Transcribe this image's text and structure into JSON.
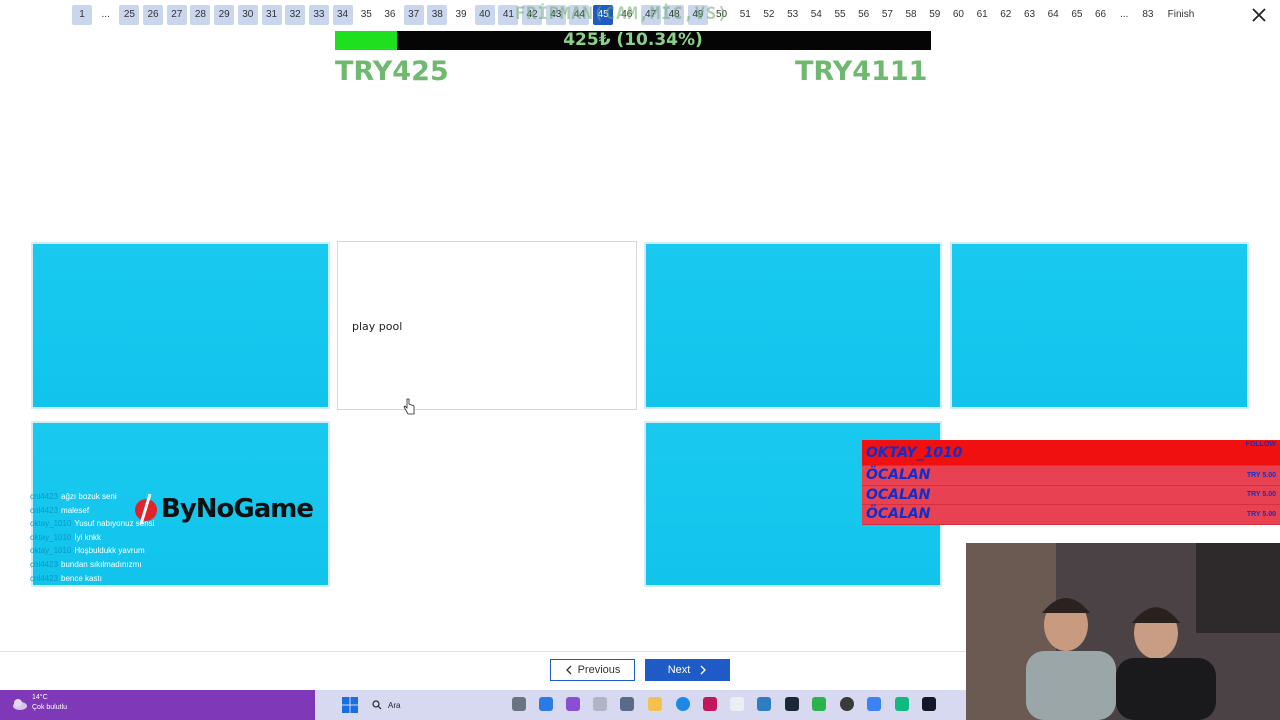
{
  "pager": {
    "first": "1",
    "ellipsis_left": "...",
    "pages": [
      "25",
      "26",
      "27",
      "28",
      "29",
      "30",
      "31",
      "32",
      "33",
      "34",
      "35",
      "36",
      "37",
      "38",
      "39",
      "40",
      "41",
      "42",
      "43",
      "44",
      "45",
      "46",
      "47",
      "48",
      "49",
      "50",
      "51",
      "52",
      "53",
      "54",
      "55",
      "56",
      "57",
      "58",
      "59",
      "60",
      "61",
      "62",
      "63",
      "64",
      "65",
      "66"
    ],
    "filled_pages": [
      "1",
      "25",
      "26",
      "27",
      "28",
      "29",
      "30",
      "31",
      "32",
      "33",
      "34",
      "37",
      "38",
      "40",
      "41",
      "42",
      "43",
      "44",
      "47",
      "48",
      "49"
    ],
    "active_page": "45",
    "ellipsis_right": "...",
    "last": "83",
    "finish_label": "Finish"
  },
  "overlay": {
    "title": "FRİPMAN(CAM,MİC,VS)",
    "progress_text": "425₺ (10.34%)",
    "progress_fraction": 0.1034,
    "amount_left": "TRY425",
    "amount_right": "TRY4111"
  },
  "cards": {
    "card2_text": "play pool"
  },
  "chat": {
    "lines": [
      {
        "user": "cnl4423",
        "text": "ağzı bozuk seni"
      },
      {
        "user": "cnl4423",
        "text": "malesef"
      },
      {
        "user": "oktay_1010",
        "text": "Yusuf nabıyonuz sensi"
      },
      {
        "user": "oktay_1010",
        "text": "İyi knkk"
      },
      {
        "user": "oktay_1010",
        "text": "Hoşbuldukk yavrum"
      },
      {
        "user": "cnl4423",
        "text": "bundan sıkılmadınızmı"
      },
      {
        "user": "cnl4423",
        "text": "bence kastı"
      }
    ],
    "brand": "ByNoGame"
  },
  "donations": {
    "header_label": "FOLLOW",
    "rows": [
      {
        "name": "OKTAY_1010",
        "amount": ""
      },
      {
        "name": "ÖCALAN",
        "amount": "TRY 5.00"
      },
      {
        "name": "OCALAN",
        "amount": "TRY 5.00"
      },
      {
        "name": "ÖCALAN",
        "amount": "TRY 5.00"
      }
    ]
  },
  "nav": {
    "previous_label": "Previous",
    "next_label": "Next"
  },
  "taskbar": {
    "weather_temp": "14°C",
    "weather_desc": "Çok bulutlu",
    "search_placeholder": "Ara"
  },
  "colors": {
    "card_cyan": "#19c9ef",
    "accent_blue": "#1e5bc6",
    "progress_green": "#1fe01f",
    "amount_green": "#6fb86f",
    "donation_red": "#e74152"
  }
}
